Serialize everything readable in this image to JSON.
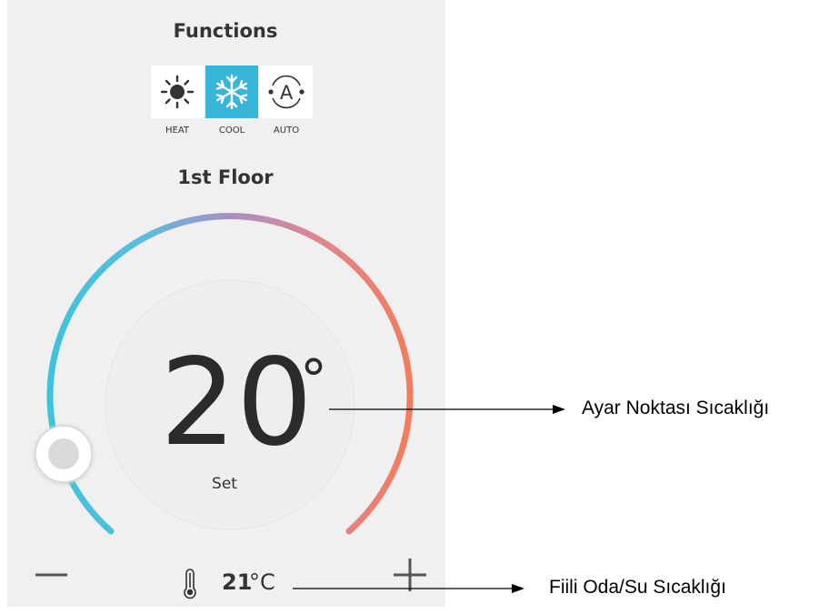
{
  "header": {
    "title": "Functions"
  },
  "functions": [
    {
      "label": "HEAT",
      "icon": "sun-icon",
      "active": false
    },
    {
      "label": "COOL",
      "icon": "snowflake-icon",
      "active": true
    },
    {
      "label": "AUTO",
      "icon": "auto-icon",
      "active": false
    }
  ],
  "zone": {
    "name": "1st Floor"
  },
  "thermostat": {
    "setpoint": "20",
    "setpoint_unit": "°",
    "set_label": "Set",
    "actual_value": "21",
    "actual_unit": "°C",
    "gradient_colors": [
      "#3ec3dc",
      "#a98fc4",
      "#f27c5c"
    ],
    "accent": "#38b6d8"
  },
  "controls": {
    "minus": "−",
    "plus": "+"
  },
  "annotations": {
    "setpoint": "Ayar Noktası Sıcaklığı",
    "actual": "Fiili Oda/Su Sıcaklığı"
  }
}
